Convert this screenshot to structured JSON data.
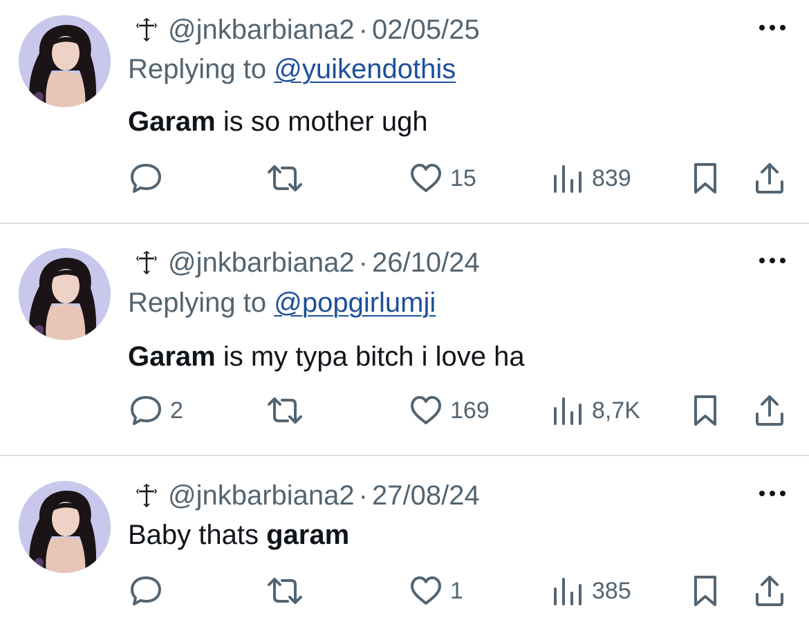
{
  "posts": [
    {
      "handle": "@jnkbarbiana2",
      "separator": "·",
      "date": "02/05/25",
      "reply_prefix": "Replying to ",
      "reply_to": "@yuikendothis",
      "text_bold": "Garam",
      "text_rest": " is so mother ugh",
      "counts": {
        "replies": "",
        "retweets": "",
        "likes": "15",
        "views": "839"
      }
    },
    {
      "handle": "@jnkbarbiana2",
      "separator": "·",
      "date": "26/10/24",
      "reply_prefix": "Replying to ",
      "reply_to": "@popgirlumji",
      "text_bold": "Garam",
      "text_rest": " is my typa bitch i love ha",
      "counts": {
        "replies": "2",
        "retweets": "",
        "likes": "169",
        "views": "8,7K"
      }
    },
    {
      "handle": "@jnkbarbiana2",
      "separator": "·",
      "date": "27/08/24",
      "text_plain": "Baby thats ",
      "text_bold": "garam",
      "counts": {
        "replies": "",
        "retweets": "",
        "likes": "1",
        "views": "385"
      }
    }
  ],
  "icons": {
    "name_prefix": "cross-icon",
    "more": "more-options-icon",
    "reply": "reply-icon",
    "retweet": "retweet-icon",
    "like": "heart-icon",
    "views": "views-icon",
    "bookmark": "bookmark-icon",
    "share": "share-icon"
  },
  "colors": {
    "text": "#0f1419",
    "secondary": "#536471",
    "link": "#1d4f9a",
    "divider": "#dcdfe2",
    "avatar_bg": "#c9c7ec"
  }
}
